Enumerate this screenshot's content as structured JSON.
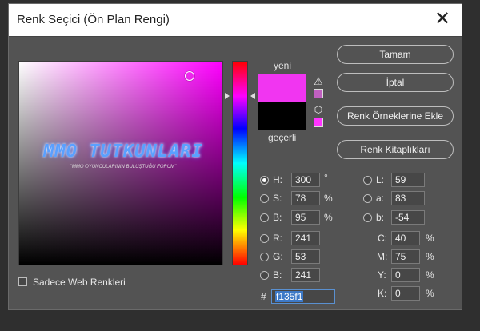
{
  "dialog": {
    "title": "Renk Seçici (Ön Plan Rengi)",
    "close": "✕"
  },
  "swatches": {
    "new_label": "yeni",
    "current_label": "geçerli",
    "new_color": "#f135f1",
    "current_color": "#000000",
    "warning_icon": "warning-triangle",
    "cube_icon": "web-safe-cube"
  },
  "buttons": {
    "ok": "Tamam",
    "cancel": "İptal",
    "add_swatches": "Renk Örneklerine Ekle",
    "libraries": "Renk Kitaplıkları"
  },
  "watermark": {
    "title": "MMO TUTKUNLARI",
    "subtitle": "\"MMO OYUNCULARININ BULUŞTUĞU FORUM\""
  },
  "fields": {
    "H": {
      "label": "H:",
      "value": "300",
      "unit": "°"
    },
    "S": {
      "label": "S:",
      "value": "78",
      "unit": "%"
    },
    "B": {
      "label": "B:",
      "value": "95",
      "unit": "%"
    },
    "R": {
      "label": "R:",
      "value": "241"
    },
    "G": {
      "label": "G:",
      "value": "53"
    },
    "Bl": {
      "label": "B:",
      "value": "241"
    },
    "L": {
      "label": "L:",
      "value": "59"
    },
    "a": {
      "label": "a:",
      "value": "83"
    },
    "b": {
      "label": "b:",
      "value": "-54"
    },
    "C": {
      "label": "C:",
      "value": "40",
      "unit": "%"
    },
    "M": {
      "label": "M:",
      "value": "75",
      "unit": "%"
    },
    "Y": {
      "label": "Y:",
      "value": "0",
      "unit": "%"
    },
    "K": {
      "label": "K:",
      "value": "0",
      "unit": "%"
    },
    "hex": {
      "label": "#",
      "value": "f135f1"
    }
  },
  "web_colors": {
    "label": "Sadece Web Renkleri"
  }
}
